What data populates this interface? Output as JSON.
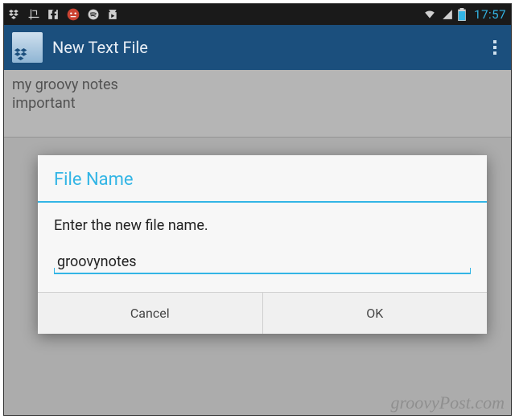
{
  "status_bar": {
    "time": "17:57",
    "icons_left": [
      "dropbox",
      "crop",
      "facebook",
      "face",
      "spotify",
      "play-store"
    ],
    "icons_right": [
      "wifi",
      "signal",
      "battery"
    ]
  },
  "action_bar": {
    "title": "New Text File",
    "app_icon": "dropbox"
  },
  "editor": {
    "text": "my groovy notes\nimportant"
  },
  "dialog": {
    "title": "File Name",
    "message": "Enter the new file name.",
    "input_value": "groovynotes",
    "cancel_label": "Cancel",
    "ok_label": "OK"
  },
  "watermark": "groovyPost.com",
  "colors": {
    "accent": "#33b5e5",
    "action_bar_bg": "#1b4f7d"
  }
}
